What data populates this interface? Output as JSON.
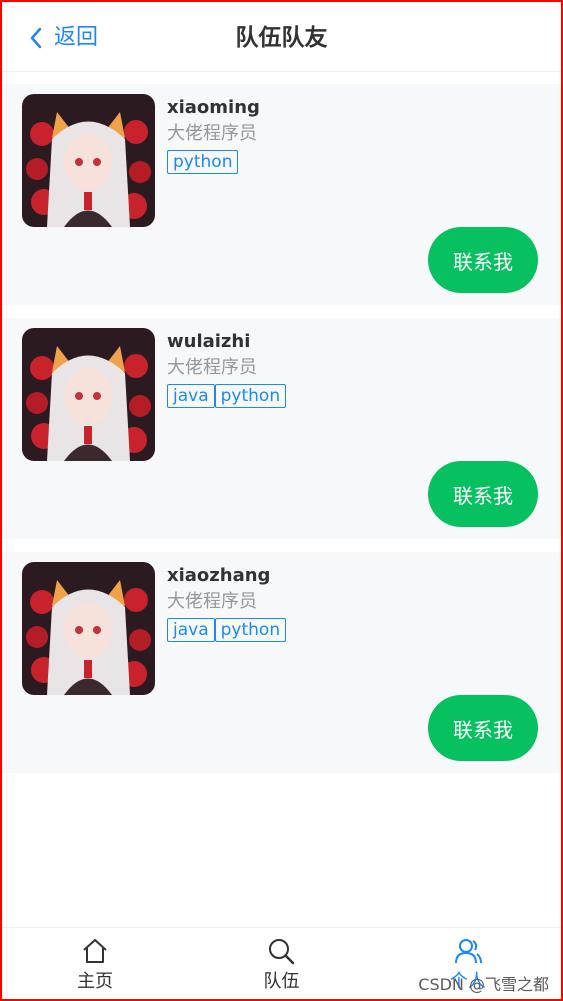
{
  "nav": {
    "back_label": "返回",
    "title": "队伍队友"
  },
  "members": [
    {
      "name": "xiaoming",
      "desc": "大佬程序员",
      "tags": [
        "python"
      ],
      "button": "联系我"
    },
    {
      "name": "wulaizhi",
      "desc": "大佬程序员",
      "tags": [
        "java",
        "python"
      ],
      "button": "联系我"
    },
    {
      "name": "xiaozhang",
      "desc": "大佬程序员",
      "tags": [
        "java",
        "python"
      ],
      "button": "联系我"
    }
  ],
  "tabbar": {
    "items": [
      {
        "label": "主页",
        "icon": "home-icon"
      },
      {
        "label": "队伍",
        "icon": "search-icon"
      },
      {
        "label": "个人",
        "icon": "user-icon",
        "active": true
      }
    ]
  },
  "watermark": "CSDN @飞雪之都",
  "colors": {
    "accent": "#1989fa",
    "button": "#07c160",
    "card_bg": "#f7f8fa",
    "frame": "#ff0000"
  }
}
